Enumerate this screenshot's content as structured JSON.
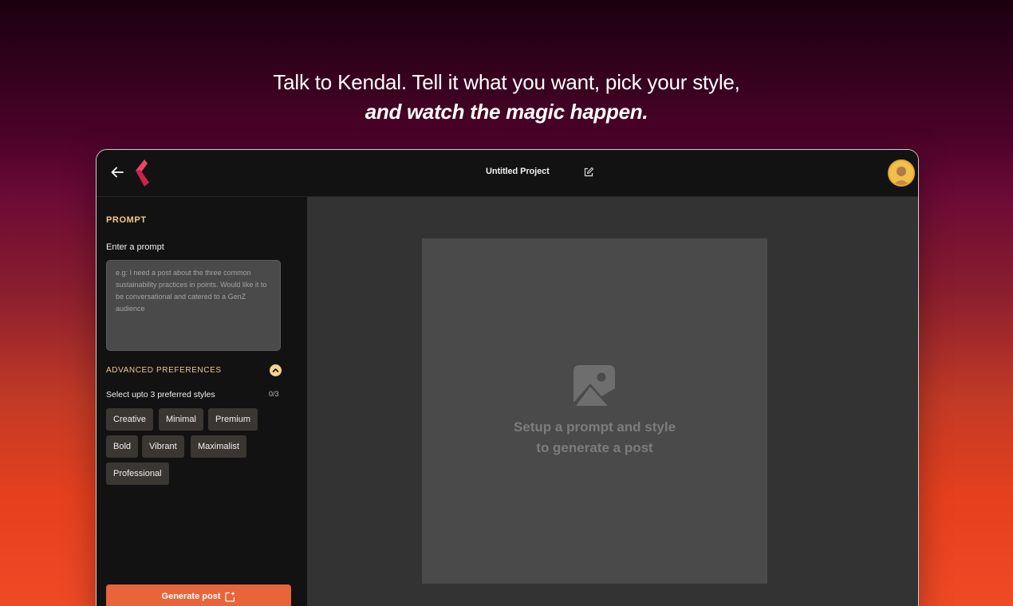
{
  "hero": {
    "line1": "Talk to Kendal. Tell it what you want, pick your style,",
    "line2": "and watch the magic happen."
  },
  "topbar": {
    "project_title": "Untitled Project",
    "back_icon": "arrow-left-icon",
    "edit_icon": "edit-icon",
    "logo": "kendal-logo"
  },
  "sidebar": {
    "section_title": "PROMPT",
    "prompt_label": "Enter a prompt",
    "prompt_placeholder": "e.g: I need a post about the three common sustainability practices in points. Would like it to be conversational and catered to a GenZ audience",
    "advanced_title": "ADVANCED PREFERENCES",
    "styles_label": "Select upto 3 preferred styles",
    "styles_count": "0/3",
    "styles": [
      "Creative",
      "Minimal",
      "Premium",
      "Bold",
      "Vibrant",
      "Maximalist",
      "Professional"
    ],
    "generate_label": "Generate post"
  },
  "canvas": {
    "placeholder_line1": "Setup a prompt and style",
    "placeholder_line2": "to generate a post"
  },
  "colors": {
    "accent": "#e8643a",
    "section_title": "#f3c98a",
    "chip_bg": "#3a3632"
  }
}
